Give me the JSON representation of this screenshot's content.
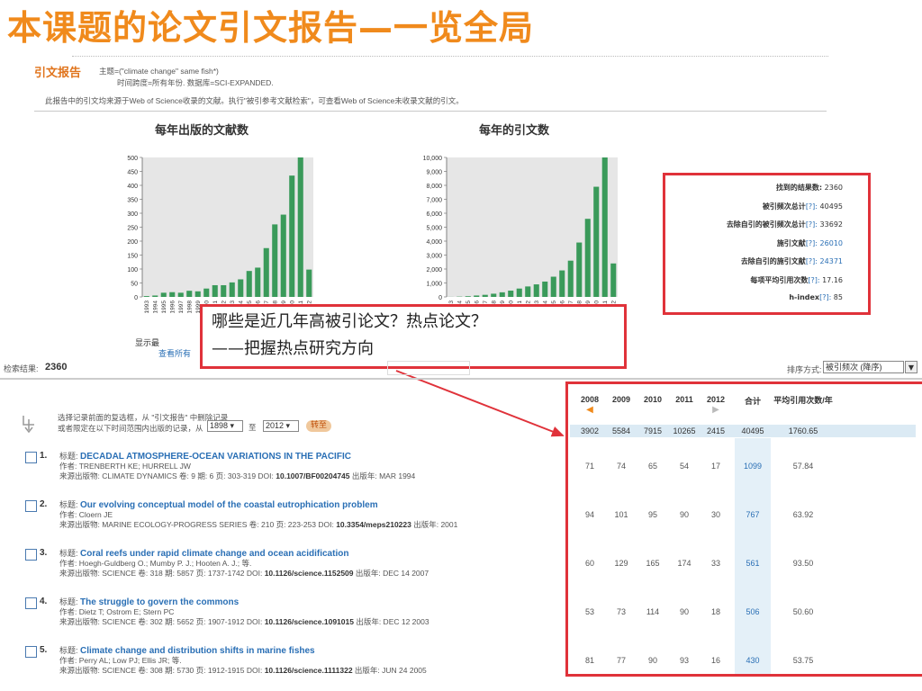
{
  "slide_title": "本课题的论文引文报告—一览全局",
  "report": {
    "label": "引文报告",
    "topic": "主题=(\"climate change\" same fish*)",
    "timespan": "时间跨度=所有年份. 数据库=SCI-EXPANDED.",
    "note": "此报告中的引文均来源于Web of Science收录的文献。执行\"被引参考文献检索\"，可查看Web of Science未收录文献的引文。"
  },
  "charts": {
    "pubs_title": "每年出版的文献数",
    "cites_title": "每年的引文数",
    "show_label": "显示最",
    "view_all": "查看所有"
  },
  "chart_data": [
    {
      "type": "bar",
      "title": "每年出版的文献数",
      "categories": [
        "1993",
        "1994",
        "1995",
        "1996",
        "1997",
        "1998",
        "1999",
        "2000",
        "2001",
        "2002",
        "2003",
        "2004",
        "2005",
        "2006",
        "2007",
        "2008",
        "2009",
        "2010",
        "2011",
        "2012"
      ],
      "values": [
        3,
        5,
        15,
        17,
        15,
        22,
        20,
        30,
        42,
        42,
        52,
        63,
        93,
        105,
        175,
        260,
        295,
        435,
        510,
        98
      ],
      "ylim": [
        0,
        500
      ],
      "yticks": [
        "500",
        "450",
        "400",
        "350",
        "300",
        "250",
        "200",
        "150",
        "100",
        "50",
        "0"
      ],
      "color": "#3a9a5a"
    },
    {
      "type": "bar",
      "title": "每年的引文数",
      "categories": [
        "1993",
        "1994",
        "1995",
        "1996",
        "1997",
        "1998",
        "1999",
        "2000",
        "2001",
        "2002",
        "2003",
        "2004",
        "2005",
        "2006",
        "2007",
        "2008",
        "2009",
        "2010",
        "2011",
        "2012"
      ],
      "values": [
        5,
        20,
        50,
        100,
        150,
        230,
        330,
        450,
        600,
        750,
        900,
        1100,
        1450,
        1900,
        2600,
        3900,
        5600,
        7900,
        10200,
        2400
      ],
      "ylim": [
        0,
        10000
      ],
      "yticks": [
        "10,000",
        "9,000",
        "8,000",
        "7,000",
        "6,000",
        "5,000",
        "4,000",
        "3,000",
        "2,000",
        "1,000",
        "0"
      ],
      "color": "#3a9a5a"
    }
  ],
  "stats": [
    {
      "label": "找到的结果数:",
      "help": "",
      "value": "2360",
      "link": false
    },
    {
      "label": "被引频次总计",
      "help": "[?]:",
      "value": "40495",
      "link": false
    },
    {
      "label": "去除自引的被引频次总计",
      "help": "[?]:",
      "value": "33692",
      "link": false
    },
    {
      "label": "施引文献",
      "help": "[?]:",
      "value": "26010",
      "link": true
    },
    {
      "label": "去除自引的施引文献",
      "help": "[?]:",
      "value": "24371",
      "link": true
    },
    {
      "label": "每项平均引用次数",
      "help": "[?]:",
      "value": "17.16",
      "link": false
    },
    {
      "label": "h-index",
      "help": "[?]:",
      "value": "85",
      "link": false
    }
  ],
  "callout": {
    "line1": "哪些是近几年高被引论文？热点论文？",
    "line2": "——把握热点研究方向"
  },
  "results": {
    "label": "检索结果:",
    "count": "2360",
    "sort_label": "排序方式:",
    "sort_value": "被引频次 (降序)"
  },
  "remove": {
    "line1": "选择记录前面的复选框，从 \"引文报告\" 中删除记录",
    "line2": "或者限定在以下时间范围内出版的记录，从",
    "from_year": "1898",
    "to_label": "至",
    "to_year": "2012",
    "go": "转至"
  },
  "table": {
    "years": [
      "2008",
      "2009",
      "2010",
      "2011",
      "2012"
    ],
    "total_label": "合计",
    "avg_label": "平均引用次数/年",
    "totals": [
      "3902",
      "5584",
      "7915",
      "10265",
      "2415",
      "40495",
      "1760.65"
    ],
    "rows": [
      {
        "cells": [
          "71",
          "74",
          "65",
          "54",
          "17"
        ],
        "total": "1099",
        "avg": "57.84"
      },
      {
        "cells": [
          "94",
          "101",
          "95",
          "90",
          "30"
        ],
        "total": "767",
        "avg": "63.92"
      },
      {
        "cells": [
          "60",
          "129",
          "165",
          "174",
          "33"
        ],
        "total": "561",
        "avg": "93.50"
      },
      {
        "cells": [
          "53",
          "73",
          "114",
          "90",
          "18"
        ],
        "total": "506",
        "avg": "50.60"
      },
      {
        "cells": [
          "81",
          "77",
          "90",
          "93",
          "16"
        ],
        "total": "430",
        "avg": "53.75"
      }
    ]
  },
  "records": [
    {
      "num": "1.",
      "title_prefix": "标题: ",
      "title": "DECADAL ATMOSPHERE-OCEAN VARIATIONS IN THE PACIFIC",
      "authors": "作者: TRENBERTH KE; HURRELL JW",
      "source_a": "来源出版物: CLIMATE DYNAMICS 卷: 9 期: 6 页: 303-319 DOI: ",
      "doi": "10.1007/BF00204745",
      "source_b": " 出版年: MAR 1994"
    },
    {
      "num": "2.",
      "title_prefix": "标题: ",
      "title": "Our evolving conceptual model of the coastal eutrophication problem",
      "authors": "作者: Cloern JE",
      "source_a": "来源出版物: MARINE ECOLOGY-PROGRESS SERIES 卷: 210 页: 223-253 DOI: ",
      "doi": "10.3354/meps210223",
      "source_b": " 出版年: 2001"
    },
    {
      "num": "3.",
      "title_prefix": "标题: ",
      "title": "Coral reefs under rapid climate change and ocean acidification",
      "authors": "作者: Hoegh-Guldberg O.; Mumby P. J.; Hooten A. J.; 等.",
      "source_a": "来源出版物: SCIENCE 卷: 318 期: 5857 页: 1737-1742 DOI: ",
      "doi": "10.1126/science.1152509",
      "source_b": " 出版年: DEC 14 2007"
    },
    {
      "num": "4.",
      "title_prefix": "标题: ",
      "title": "The struggle to govern the commons",
      "authors": "作者: Dietz T; Ostrom E; Stern PC",
      "source_a": "来源出版物: SCIENCE 卷: 302 期: 5652 页: 1907-1912 DOI: ",
      "doi": "10.1126/science.1091015",
      "source_b": " 出版年: DEC 12 2003"
    },
    {
      "num": "5.",
      "title_prefix": "标题: ",
      "title": "Climate change and distribution shifts in marine fishes",
      "authors": "作者: Perry AL; Low PJ; Ellis JR; 等.",
      "source_a": "来源出版物: SCIENCE 卷: 308 期: 5730 页: 1912-1915 DOI: ",
      "doi": "10.1126/science.1111322",
      "source_b": " 出版年: JUN 24 2005"
    }
  ]
}
